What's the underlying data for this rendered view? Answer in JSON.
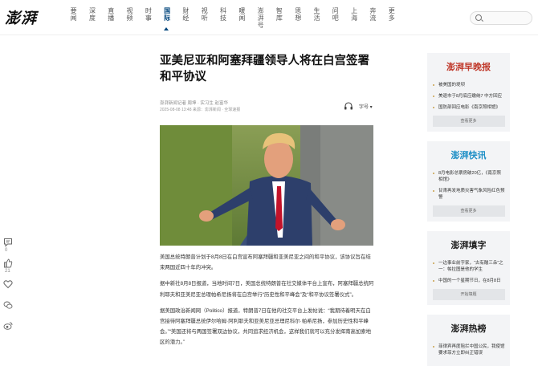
{
  "site": {
    "logo": "澎湃"
  },
  "nav": [
    {
      "label": "要闻",
      "active": false
    },
    {
      "label": "深度",
      "active": false
    },
    {
      "label": "直播",
      "active": false
    },
    {
      "label": "视频",
      "active": false
    },
    {
      "label": "时事",
      "active": false
    },
    {
      "label": "国际",
      "active": true
    },
    {
      "label": "财经",
      "active": false
    },
    {
      "label": "视听",
      "active": false
    },
    {
      "label": "科技",
      "active": false
    },
    {
      "label": "暖闻",
      "active": false
    },
    {
      "label": "澎湃号",
      "active": false
    },
    {
      "label": "智库",
      "active": false
    },
    {
      "label": "思想",
      "active": false
    },
    {
      "label": "生活",
      "active": false
    },
    {
      "label": "问吧",
      "active": false
    },
    {
      "label": "上海",
      "active": false
    },
    {
      "label": "奔流",
      "active": false
    },
    {
      "label": "更多",
      "active": false
    }
  ],
  "article": {
    "title": "亚美尼亚和阿塞拜疆领导人将在白宫签署和平协议",
    "source": "澎湃新闻记者 周坤 · 实习生 赵富华",
    "time": "2025-08-08 13:48 来源：澎湃新闻 · 全球速报",
    "font_label": "字号",
    "paragraphs": [
      "美国总统特朗普计划于8月8日在白宫宣布阿塞拜疆和亚美尼亚之间的和平协议，该协议旨在结束两国近四十年的冲突。",
      "据中新社8月8日报道，当地时间7日，美国总统特朗普在社交媒体平台上宣布，阿塞拜疆总统阿利耶夫和亚美尼亚总理帕希尼扬将在白宫举行“历史性和平峰会”及“和平协议签署仪式”。",
      "据美国政治新闻网（Politico）报道，特朗普7日在他的社交平台上发帖说：“我期待着明天在白宫接待阿塞拜疆总统伊尔哈姆·阿利耶夫和亚美尼亚总理尼科尔·帕希尼扬，参加历史性和平峰会。”“美国还将与两国签署双边协议，共同追求经济机会，这样我们就可以充分发挥南高加索地区的潜力。”"
    ]
  },
  "tools": [
    {
      "name": "comment",
      "count": "0"
    },
    {
      "name": "like",
      "count": "21"
    },
    {
      "name": "favorite",
      "count": ""
    },
    {
      "name": "share-wechat",
      "count": ""
    },
    {
      "name": "share-weibo",
      "count": ""
    }
  ],
  "cards": [
    {
      "logo": "澎湃早晚报",
      "logo_color": "#c0392b",
      "items": [
        "被美国的堤坝",
        "美退市于8月底应缴纳7 中方回应",
        "国防部回应电影《南京照相馆》"
      ],
      "more": "查看更多"
    },
    {
      "logo": "澎湃快讯",
      "logo_color": "#1e8fc6",
      "items": [
        "8月电影总票房破20亿，《南京照相馆》",
        "甘肃再发地质灾害气象风险红色预警"
      ],
      "more": "查看更多"
    },
    {
      "logo": "澎湃填字",
      "logo_color": "#222",
      "items": [
        "一边事业前字家，“古有酸三朵”之一：帕拉图是他的学生",
        "中国的一个星期节日，在8月8日"
      ],
      "more": "开始填题"
    },
    {
      "logo": "澎湃热榜",
      "logo_color": "#222",
      "items": [
        "菲律宾再度阻拦中国公民，我使馆要求菲方立即纠正错误"
      ],
      "more": ""
    }
  ]
}
